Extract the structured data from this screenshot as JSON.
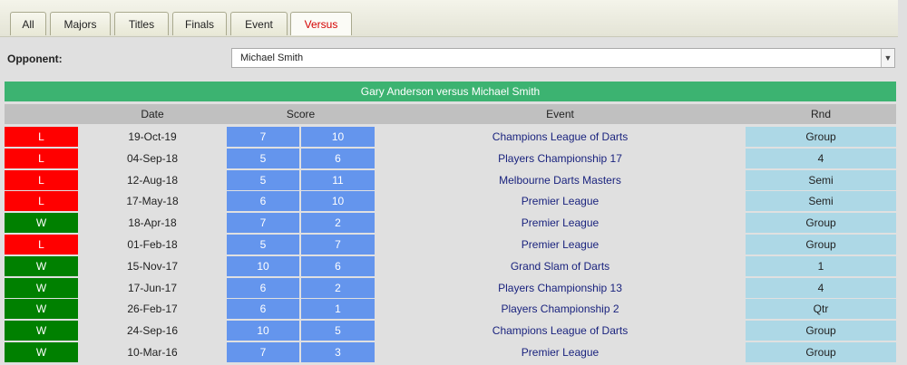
{
  "tabs": [
    {
      "label": "All",
      "active": false
    },
    {
      "label": "Majors",
      "active": false
    },
    {
      "label": "Titles",
      "active": false
    },
    {
      "label": "Finals",
      "active": false
    },
    {
      "label": "Event",
      "active": false
    },
    {
      "label": "Versus",
      "active": true
    }
  ],
  "opponent": {
    "label": "Opponent:",
    "selected": "Michael Smith"
  },
  "matchup_title": "Gary Anderson versus Michael Smith",
  "columns": {
    "date": "Date",
    "score": "Score",
    "event": "Event",
    "rnd": "Rnd"
  },
  "colors": {
    "loss": "#ff0000",
    "win": "#008000",
    "score_bg": "#6495ed",
    "round_bg": "#add8e6",
    "header_green": "#3cb371",
    "active_tab_text": "#d40000"
  },
  "matches": [
    {
      "result": "L",
      "date": "19-Oct-19",
      "score_a": "7",
      "score_b": "10",
      "event": "Champions League of Darts",
      "rnd": "Group"
    },
    {
      "result": "L",
      "date": "04-Sep-18",
      "score_a": "5",
      "score_b": "6",
      "event": "Players Championship 17",
      "rnd": "4"
    },
    {
      "result": "L",
      "date": "12-Aug-18",
      "score_a": "5",
      "score_b": "11",
      "event": "Melbourne Darts Masters",
      "rnd": "Semi"
    },
    {
      "result": "L",
      "date": "17-May-18",
      "score_a": "6",
      "score_b": "10",
      "event": "Premier League",
      "rnd": "Semi"
    },
    {
      "result": "W",
      "date": "18-Apr-18",
      "score_a": "7",
      "score_b": "2",
      "event": "Premier League",
      "rnd": "Group"
    },
    {
      "result": "L",
      "date": "01-Feb-18",
      "score_a": "5",
      "score_b": "7",
      "event": "Premier League",
      "rnd": "Group"
    },
    {
      "result": "W",
      "date": "15-Nov-17",
      "score_a": "10",
      "score_b": "6",
      "event": "Grand Slam of Darts",
      "rnd": "1"
    },
    {
      "result": "W",
      "date": "17-Jun-17",
      "score_a": "6",
      "score_b": "2",
      "event": "Players Championship 13",
      "rnd": "4"
    },
    {
      "result": "W",
      "date": "26-Feb-17",
      "score_a": "6",
      "score_b": "1",
      "event": "Players Championship 2",
      "rnd": "Qtr"
    },
    {
      "result": "W",
      "date": "24-Sep-16",
      "score_a": "10",
      "score_b": "5",
      "event": "Champions League of Darts",
      "rnd": "Group"
    },
    {
      "result": "W",
      "date": "10-Mar-16",
      "score_a": "7",
      "score_b": "3",
      "event": "Premier League",
      "rnd": "Group"
    }
  ]
}
